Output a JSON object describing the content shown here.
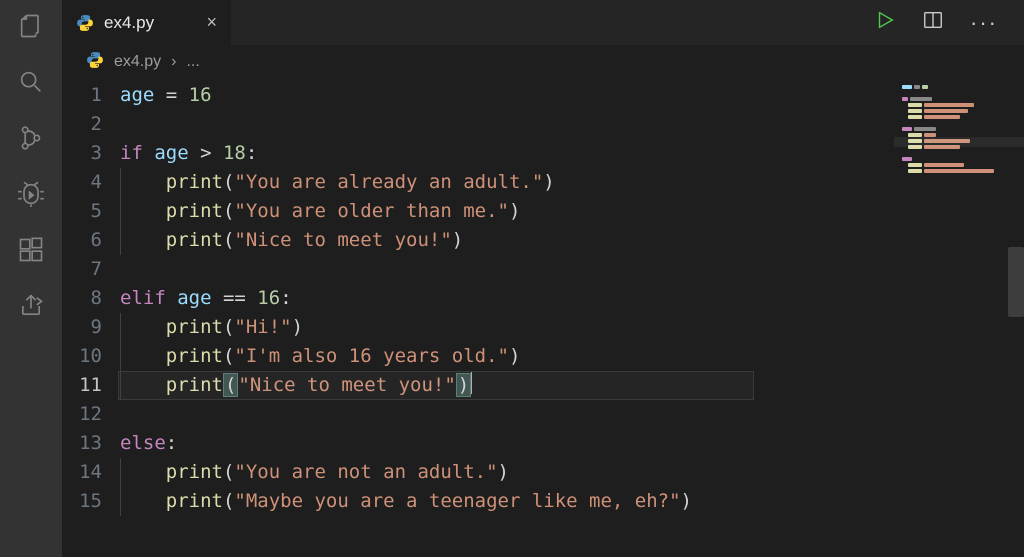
{
  "activity": {
    "items": [
      "explorer",
      "search",
      "source-control",
      "debug",
      "extensions",
      "live-share"
    ]
  },
  "tab": {
    "filename": "ex4.py",
    "close_glyph": "×"
  },
  "actions": {
    "run": "run",
    "split": "split",
    "more": "···"
  },
  "breadcrumb": {
    "file": "ex4.py",
    "chevron": "›",
    "rest": "..."
  },
  "gutter": [
    "1",
    "2",
    "3",
    "4",
    "5",
    "6",
    "7",
    "8",
    "9",
    "10",
    "11",
    "12",
    "13",
    "14",
    "15"
  ],
  "code": {
    "l1": {
      "a": "age",
      "b": " = ",
      "c": "16"
    },
    "l3": {
      "a": "if ",
      "b": "age",
      "c": " > ",
      "d": "18",
      "e": ":"
    },
    "l4": {
      "a": "print",
      "b": "(",
      "c": "\"You are already an adult.\"",
      "d": ")"
    },
    "l5": {
      "a": "print",
      "b": "(",
      "c": "\"You are older than me.\"",
      "d": ")"
    },
    "l6": {
      "a": "print",
      "b": "(",
      "c": "\"Nice to meet you!\"",
      "d": ")"
    },
    "l8": {
      "a": "elif ",
      "b": "age",
      "c": " == ",
      "d": "16",
      "e": ":"
    },
    "l9": {
      "a": "print",
      "b": "(",
      "c": "\"Hi!\"",
      "d": ")"
    },
    "l10": {
      "a": "print",
      "b": "(",
      "c": "\"I'm also 16 years old.\"",
      "d": ")"
    },
    "l11": {
      "a": "print",
      "b": "(",
      "c": "\"Nice to meet you!\"",
      "d": ")"
    },
    "l13": {
      "a": "else",
      "b": ":"
    },
    "l14": {
      "a": "print",
      "b": "(",
      "c": "\"You are not an adult.\"",
      "d": ")"
    },
    "l15": {
      "a": "print",
      "b": "(",
      "c": "\"Maybe you are a teenager like me, eh?\"",
      "d": ")"
    }
  },
  "colors": {
    "keyword": "#c586c0",
    "variable": "#9cdcfe",
    "number": "#b5cea8",
    "function": "#dcdcaa",
    "string": "#ce9178",
    "punct": "#d4d4d4"
  }
}
